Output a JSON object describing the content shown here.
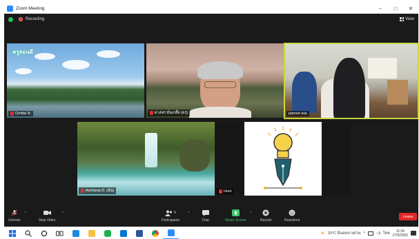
{
  "window": {
    "title": "Zoom Meeting",
    "minimize": "–",
    "maximize": "□",
    "close": "✕"
  },
  "topbar": {
    "recording_label": "Recording",
    "view_label": "View"
  },
  "tiles": [
    {
      "name": "Ontida N."
    },
    {
      "name": "ดวงพร มั่นเกลี้ย (ดรุ)"
    },
    {
      "name": "pannet suk"
    },
    {
      "name": "Anchana D. (ฉัน)"
    },
    {
      "name": "Host"
    }
  ],
  "tile1_logo": "ครูสอนดี",
  "toolbar": {
    "unmute": "Unmute",
    "stop_video": "Stop Video",
    "participants": "Participants",
    "participants_count": "5",
    "chat": "Chat",
    "share_screen": "Share Screen",
    "record": "Record",
    "reactions": "Reactions",
    "leave": "Leave"
  },
  "taskbar": {
    "weather": "33°C มีแดดบางส่วน",
    "language": "ไทย",
    "time": "11:34",
    "date": "27/5/2565"
  },
  "colors": {
    "accent_green": "#22c55e",
    "leave_red": "#e02828",
    "active_border": "#c8d83c",
    "share_green": "#3fc56b"
  }
}
